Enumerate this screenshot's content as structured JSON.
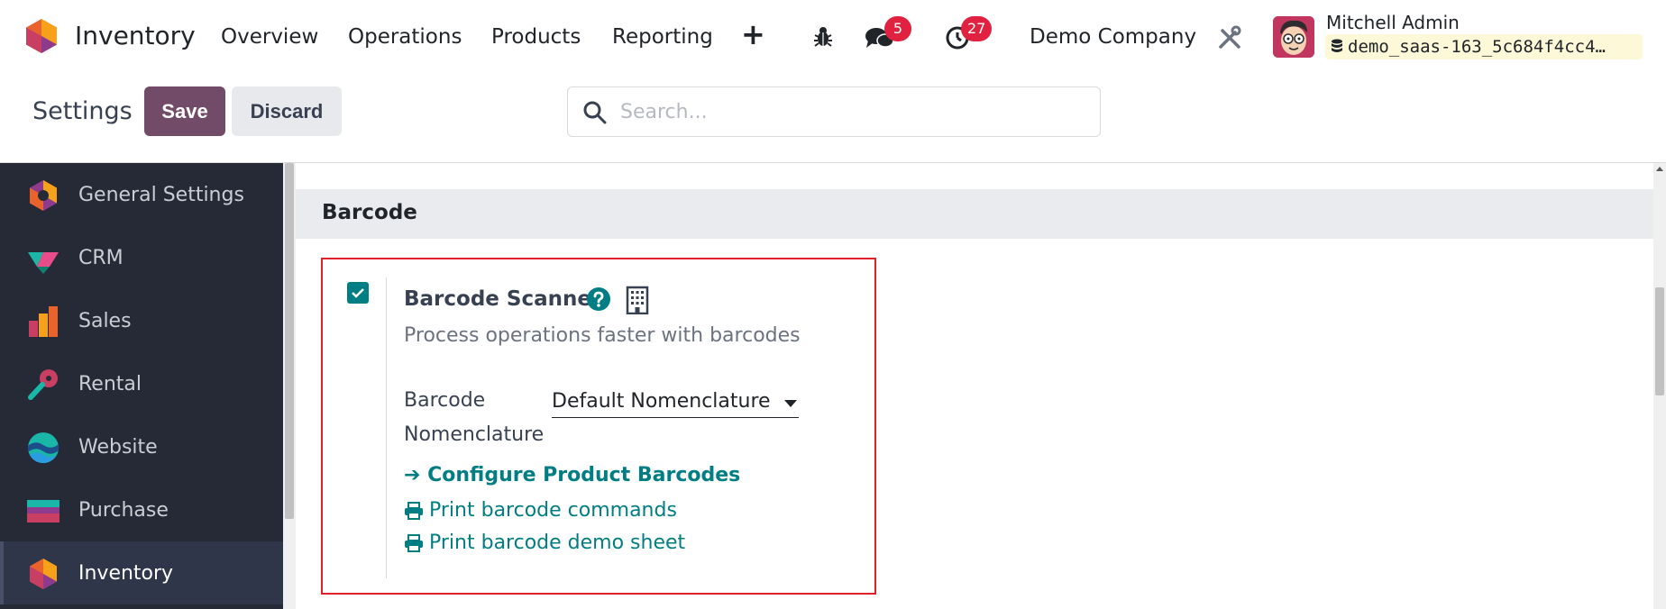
{
  "navbar": {
    "app_title": "Inventory",
    "menus": [
      "Overview",
      "Operations",
      "Products",
      "Reporting"
    ],
    "plus_symbol": "+",
    "messages_count": "5",
    "activities_count": "27",
    "company": "Demo Company",
    "user_name": "Mitchell Admin",
    "database": "demo_saas-163_5c684f4cc4…"
  },
  "control_panel": {
    "title": "Settings",
    "save_label": "Save",
    "discard_label": "Discard",
    "search_placeholder": "Search..."
  },
  "sidebar": {
    "items": [
      {
        "label": "General Settings",
        "icon": "general-settings-icon"
      },
      {
        "label": "CRM",
        "icon": "crm-icon"
      },
      {
        "label": "Sales",
        "icon": "sales-icon"
      },
      {
        "label": "Rental",
        "icon": "rental-icon"
      },
      {
        "label": "Website",
        "icon": "website-icon"
      },
      {
        "label": "Purchase",
        "icon": "purchase-icon"
      },
      {
        "label": "Inventory",
        "icon": "inventory-icon",
        "active": true
      }
    ]
  },
  "section": {
    "title": "Barcode",
    "setting": {
      "title": "Barcode Scanner",
      "checked": true,
      "description": "Process operations faster with barcodes",
      "field_label_line1": "Barcode",
      "field_label_line2": "Nomenclature",
      "field_value": "Default Nomenclature",
      "link_configure": "➔ Configure Product Barcodes",
      "link_print_commands": "Print barcode commands",
      "link_print_demo": "Print barcode demo sheet"
    }
  },
  "colors": {
    "brand_primary": "#714b67",
    "accent_teal": "#017e84",
    "highlight_red": "#e0212b",
    "badge_red": "#e0213f",
    "sidebar_bg": "#262a36"
  }
}
